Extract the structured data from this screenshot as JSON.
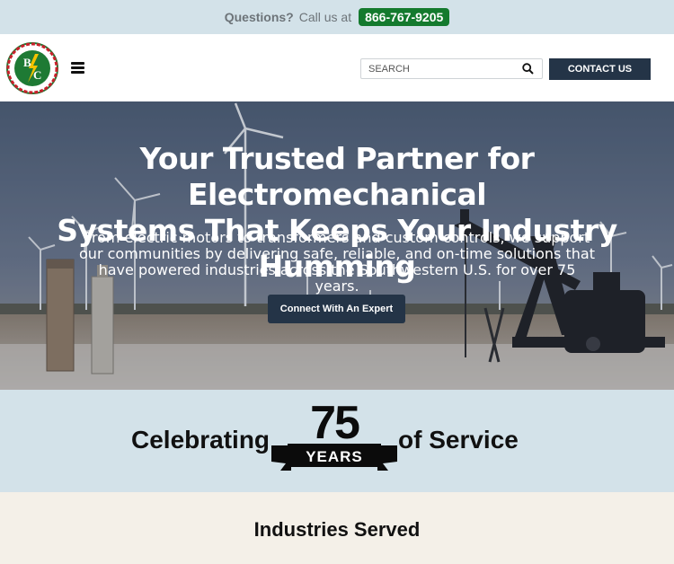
{
  "topbar": {
    "question": "Questions?",
    "call_text": "Call us at",
    "phone": "866-767-9205"
  },
  "header": {
    "logo_icon": "brandon-clark-logo",
    "menu_icon": "hamburger-menu-icon",
    "search_placeholder": "SEARCH",
    "search_icon": "search-icon",
    "contact_label": "CONTACT US"
  },
  "hero": {
    "headline_line1": "Your Trusted Partner for Electromechanical",
    "headline_line2": "Systems That Keeps Your Industry Humming",
    "body_line1": "From electric motors to transformers and custom controls, we support",
    "body_line2": "our communities by delivering safe, reliable, and on-time solutions that",
    "body_line3": "have powered industries across the Southwestern U.S. for over 75 years.",
    "cta_label": "Connect With An Expert"
  },
  "celebrate": {
    "before": "Celebrating",
    "number": "75",
    "banner": "YEARS",
    "after": "of Service"
  },
  "industries": {
    "title": "Industries Served"
  },
  "colors": {
    "topbar_bg": "#d3e2e9",
    "phone_bg": "#147a2e",
    "navy": "#243447",
    "cream": "#f4f0e8"
  }
}
